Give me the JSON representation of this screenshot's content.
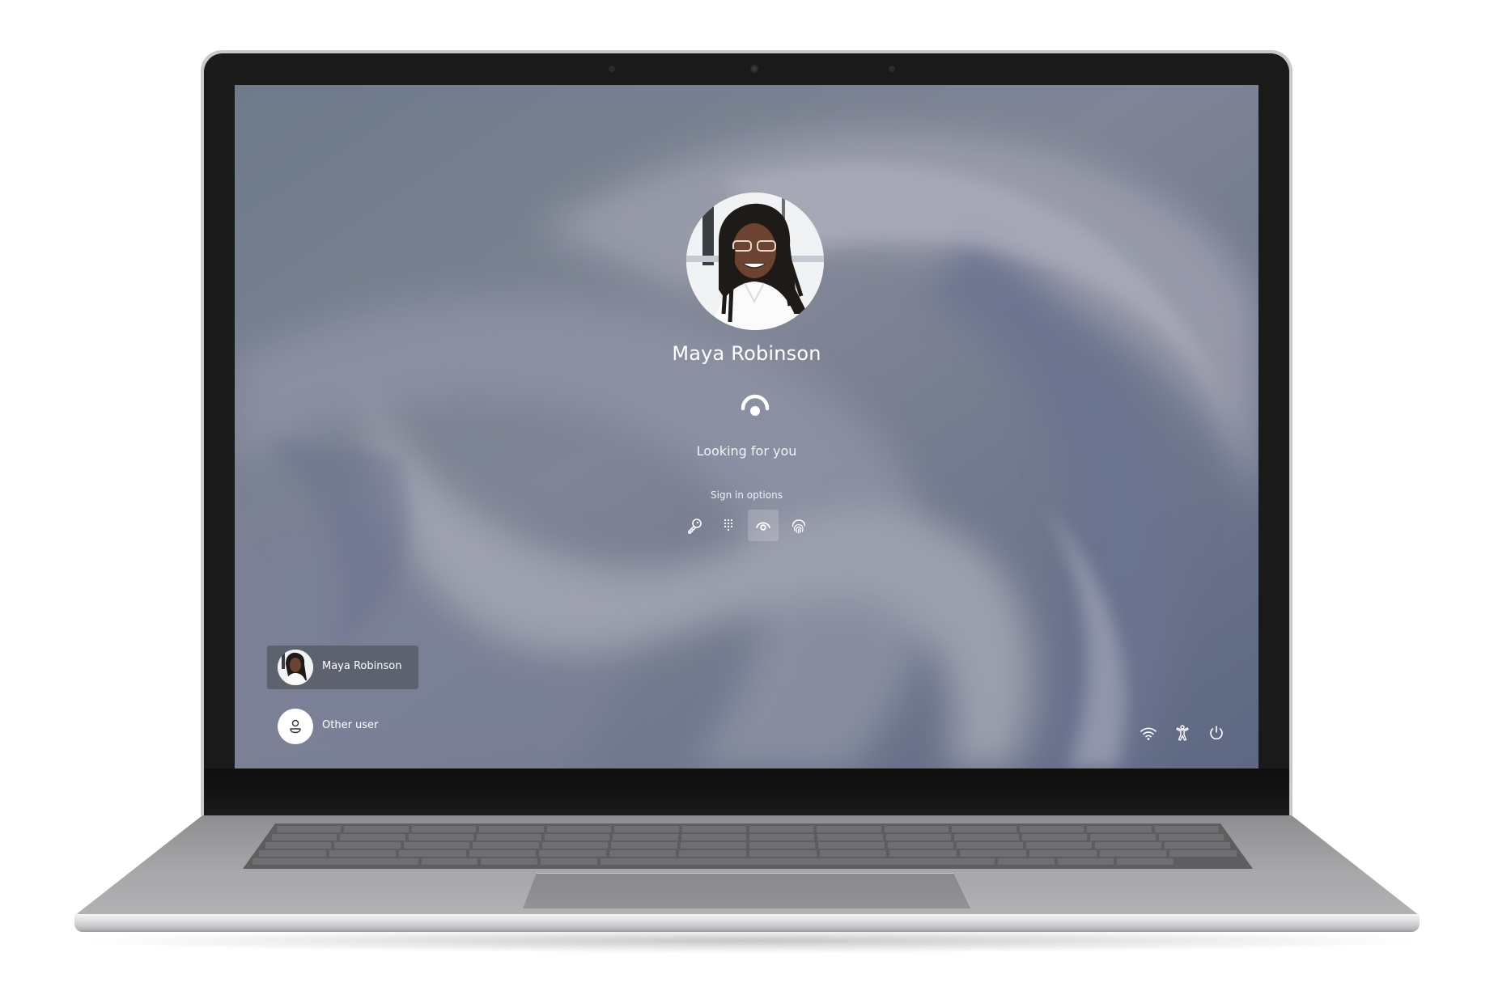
{
  "lock_screen": {
    "user_name": "Maya Robinson",
    "status_text": "Looking for you",
    "sign_in_options_label": "Sign in options",
    "sign_in_options": [
      {
        "icon": "key-icon",
        "label": "Password",
        "selected": false
      },
      {
        "icon": "pin-keypad-icon",
        "label": "PIN",
        "selected": false
      },
      {
        "icon": "face-recognition-icon",
        "label": "Facial recognition",
        "selected": true
      },
      {
        "icon": "fingerprint-icon",
        "label": "Fingerprint",
        "selected": false
      }
    ]
  },
  "user_list": [
    {
      "name": "Maya Robinson",
      "avatar": "user-photo",
      "selected": true
    },
    {
      "name": "Other user",
      "avatar": "person-icon",
      "selected": false
    }
  ],
  "tray": [
    {
      "icon": "wifi-icon",
      "label": "Network"
    },
    {
      "icon": "accessibility-icon",
      "label": "Accessibility"
    },
    {
      "icon": "power-icon",
      "label": "Power"
    }
  ],
  "colors": {
    "wallpaper_base": "#75808f",
    "wallpaper_swirl": "#9aa0b0",
    "selected_tile": "#5f6270",
    "text": "#ffffff"
  }
}
